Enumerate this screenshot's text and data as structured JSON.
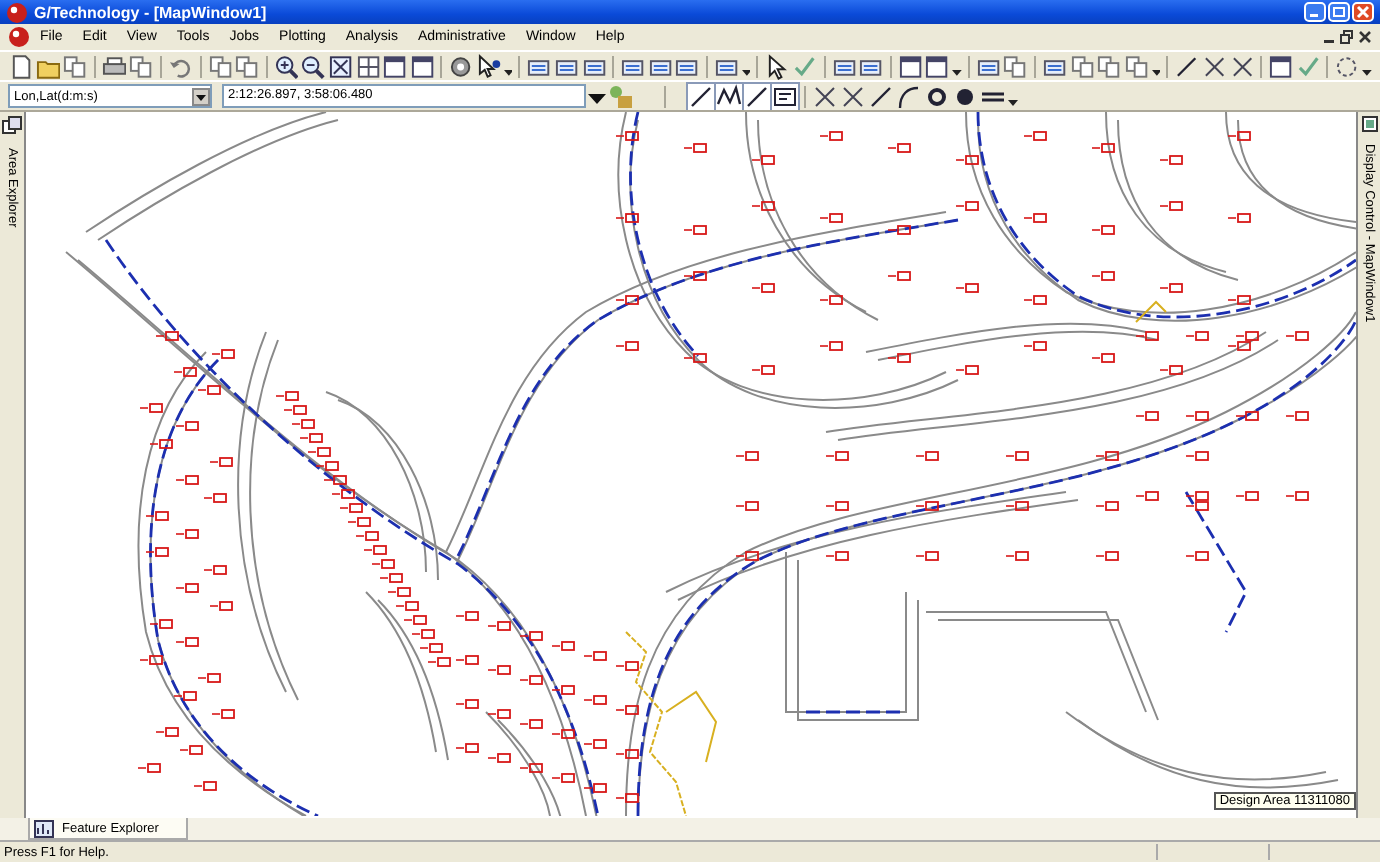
{
  "window": {
    "title": "G/Technology - [MapWindow1]"
  },
  "menu": [
    {
      "label": "File"
    },
    {
      "label": "Edit"
    },
    {
      "label": "View"
    },
    {
      "label": "Tools"
    },
    {
      "label": "Jobs"
    },
    {
      "label": "Plotting"
    },
    {
      "label": "Analysis"
    },
    {
      "label": "Administrative"
    },
    {
      "label": "Window"
    },
    {
      "label": "Help"
    }
  ],
  "coordinate_bar": {
    "format": "Lon,Lat(d:m:s)",
    "value": "2:12:26.897, 3:58:06.480"
  },
  "left_panel": {
    "tab": "Area Explorer"
  },
  "right_panel": {
    "tab": "Display Control - MapWindow1"
  },
  "map": {
    "label": "Design Area 11311080"
  },
  "bottom_tabs": [
    {
      "label": "Feature Explorer",
      "selected": true
    }
  ],
  "status_bar": {
    "text": "Press F1 for Help."
  }
}
